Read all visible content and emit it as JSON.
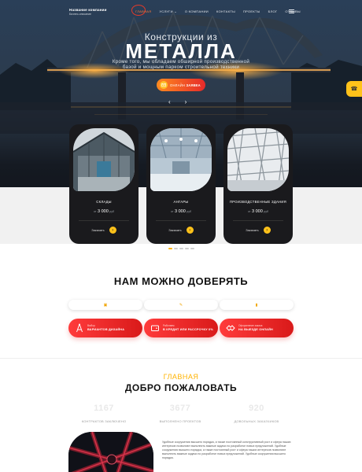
{
  "brand": {
    "title": "Название компании",
    "subtitle": "Бизнес-описание"
  },
  "nav": {
    "items": [
      "ГЛАВНАЯ",
      "УСЛУГИ",
      "О КОМПАНИИ",
      "КОНТАКТЫ",
      "ПРОЕКТЫ",
      "БЛОГ",
      "ОТЗЫВЫ"
    ],
    "services_chevron": "⌄"
  },
  "hero": {
    "pre_title": "Конструкции из",
    "title": "МЕТАЛЛА",
    "subtitle": "Кроме того, мы обладаем обширной производственной базой и мощным парком строительной техники",
    "cta_prefix": "ОНЛАЙН",
    "cta_bold": "ЗАЯВКА",
    "prev_arrow": "‹",
    "next_arrow": "›",
    "side_icon": "☎"
  },
  "cards": [
    {
      "title": "СКЛАДЫ",
      "price_prefix": "от",
      "price": "3 000",
      "unit": "руб",
      "order": "Заказать",
      "arrow": "›"
    },
    {
      "title": "АНГАРЫ",
      "price_prefix": "от",
      "price": "3 000",
      "unit": "руб",
      "order": "Заказать",
      "arrow": "›"
    },
    {
      "title": "ПРОИЗВОДСТВЕННЫЕ ЗДАНИЯ",
      "price_prefix": "от",
      "price": "3 000",
      "unit": "руб",
      "order": "Заказать",
      "arrow": "›"
    }
  ],
  "trust": {
    "title": "НАМ МОЖНО ДОВЕРЯТЬ",
    "pills": [
      "▣",
      "✎",
      "▮"
    ],
    "features": [
      {
        "line1": "Выбор",
        "line2": "ВАРИАНТОВ ДИЗАЙНА"
      },
      {
        "line1": "Работаем",
        "line2": "В КРЕДИТ ИЛИ РАССРОЧКУ 0%"
      },
      {
        "line1": "Оформление заказа",
        "line2": "НА ВЫЕЗДЕ ОНЛАЙН"
      }
    ]
  },
  "welcome": {
    "eyebrow": "ГЛАВНАЯ",
    "title": "ДОБРО ПОЖАЛОВАТЬ",
    "stats": [
      {
        "number": "1167",
        "label": "КОНТРАКТОВ ЗАКЛЮЧЕНО"
      },
      {
        "number": "3677",
        "label": "ВЫПОЛНЕНО ПРОЕКТОВ"
      },
      {
        "number": "920",
        "label": "ДОВОЛЬНЫХ ЗАКАЗЧИКОВ"
      }
    ],
    "text": "Удобные сооружения высшего порядка, а также постоянный конструктивный рост и сфера наших интересов позволяют выполнить важные задачи по разработке новых предложений. Удобные сооружения высшего порядка, а также постоянный рост и сфера наших интересов позволяют выполнить важные задачи по разработке новых предложений. Удобные сооружения высшего порядка."
  },
  "colors": {
    "accent": "#ffc21a",
    "red": "#e62a2a",
    "dark": "#1a1a1d"
  }
}
